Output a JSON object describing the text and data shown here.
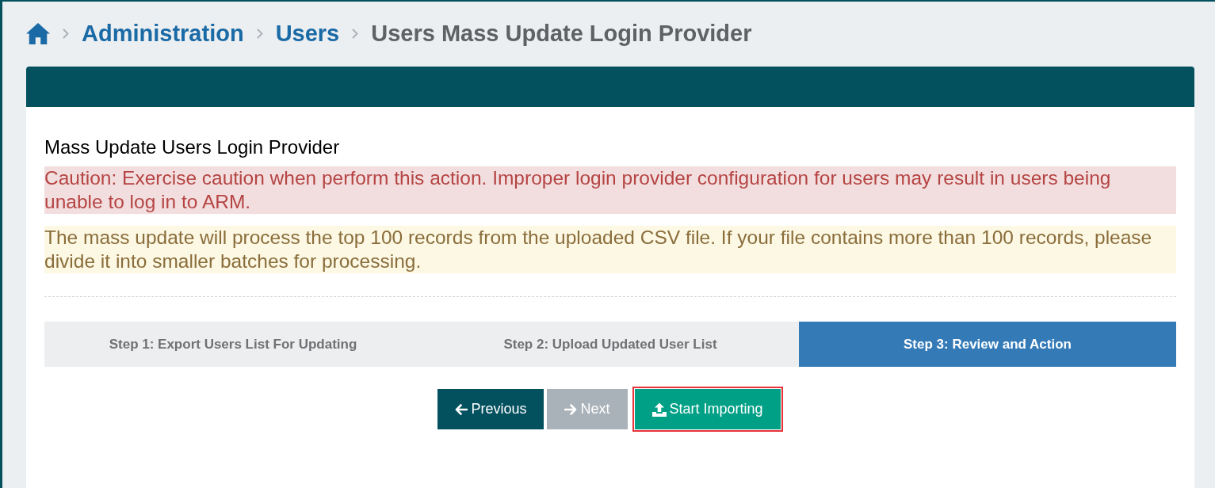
{
  "breadcrumb": [
    {
      "label": "Administration",
      "kind": "link"
    },
    {
      "label": "Users",
      "kind": "link"
    },
    {
      "label": "Users Mass Update Login Provider",
      "kind": "current"
    }
  ],
  "card": {
    "title": "Mass Update Users Login Provider",
    "alerts": [
      {
        "kind": "danger",
        "text": "Caution: Exercise caution when perform this action. Improper login provider configuration for users may result in users being unable to log in to ARM."
      },
      {
        "kind": "warning",
        "text": "The mass update will process the top 100 records from the uploaded CSV file. If your file contains more than 100 records, please divide it into smaller batches for processing."
      }
    ],
    "steps": [
      {
        "label": "Step 1: Export Users List For Updating",
        "selected": false
      },
      {
        "label": "Step 2: Upload Updated User List",
        "selected": false
      },
      {
        "label": "Step 3: Review and Action",
        "selected": true
      }
    ],
    "buttons": [
      {
        "label": "Previous",
        "kind": "back",
        "disabled": false,
        "highlighted": false
      },
      {
        "label": "Next",
        "kind": "forward",
        "disabled": true,
        "highlighted": false
      },
      {
        "label": "Start Importing",
        "kind": "import",
        "disabled": false,
        "highlighted": true
      }
    ]
  }
}
